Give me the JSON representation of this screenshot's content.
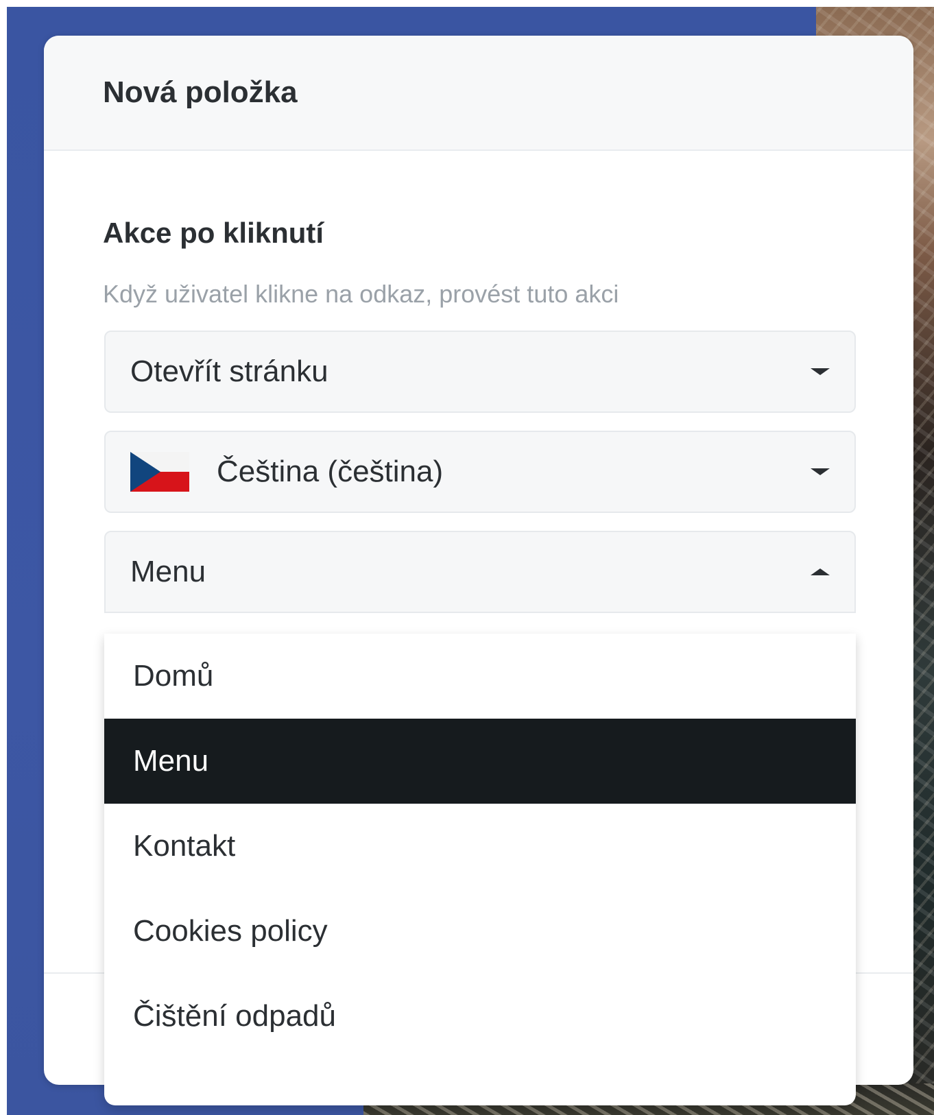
{
  "dialog": {
    "title": "Nová položka"
  },
  "section": {
    "title": "Akce po kliknutí",
    "hint": "Když uživatel klikne na odkaz, provést tuto akci"
  },
  "action_select": {
    "value": "Otevřít stránku",
    "icon": "chevron-down-icon"
  },
  "language_select": {
    "value": "Čeština (čeština)",
    "flag_icon": "czech-flag-icon",
    "icon": "chevron-down-icon"
  },
  "page_select": {
    "value": "Menu",
    "icon": "chevron-up-icon",
    "options": [
      {
        "label": "Domů",
        "selected": false
      },
      {
        "label": "Menu",
        "selected": true
      },
      {
        "label": "Kontakt",
        "selected": false
      },
      {
        "label": "Cookies policy",
        "selected": false
      },
      {
        "label": "Čištění odpadů",
        "selected": false
      }
    ]
  },
  "colors": {
    "backdrop": "#3b55a2",
    "highlight": "#161b1e",
    "flag_blue": "#11457e",
    "flag_red": "#d7141a"
  }
}
